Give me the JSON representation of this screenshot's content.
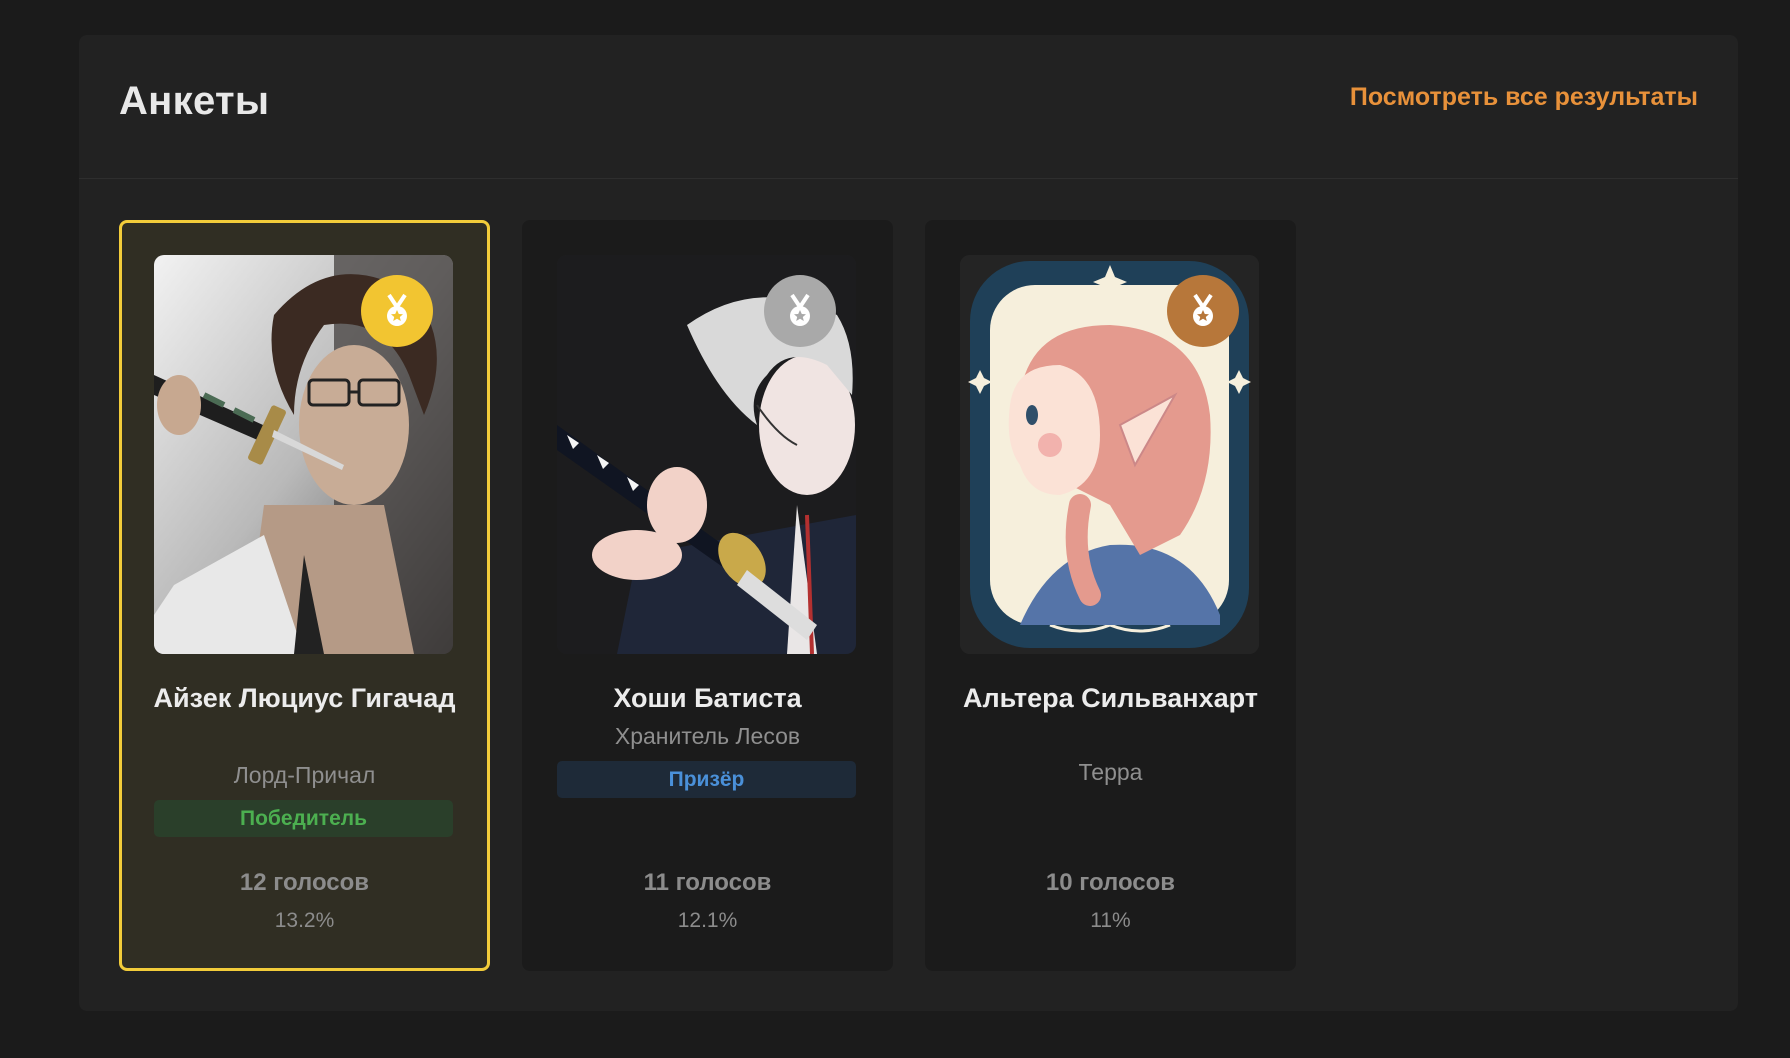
{
  "header": {
    "title": "Анкеты",
    "see_all_link": "Посмотреть все результаты"
  },
  "cards": [
    {
      "name": "Айзек Люциус Гигачад",
      "subtitle": "Лорд-Причал",
      "badge": "Победитель",
      "votes": "12 голосов",
      "percent": "13.2%",
      "medal": "gold-medal-icon"
    },
    {
      "name": "Хоши Батиста",
      "subtitle": "Хранитель Лесов",
      "badge": "Призёр",
      "votes": "11 голосов",
      "percent": "12.1%",
      "medal": "silver-medal-icon"
    },
    {
      "name": "Альтера Сильванхарт",
      "subtitle": "Терра",
      "badge": "",
      "votes": "10 голосов",
      "percent": "11%",
      "medal": "bronze-medal-icon"
    }
  ],
  "colors": {
    "accent_link": "#e8913a",
    "winner_border": "#f2cc3a",
    "gold": "#f2c531",
    "silver": "#a9a9a9",
    "bronze": "#b7773a",
    "winner_badge": "#4caf50",
    "prize_badge": "#4a90d9"
  }
}
